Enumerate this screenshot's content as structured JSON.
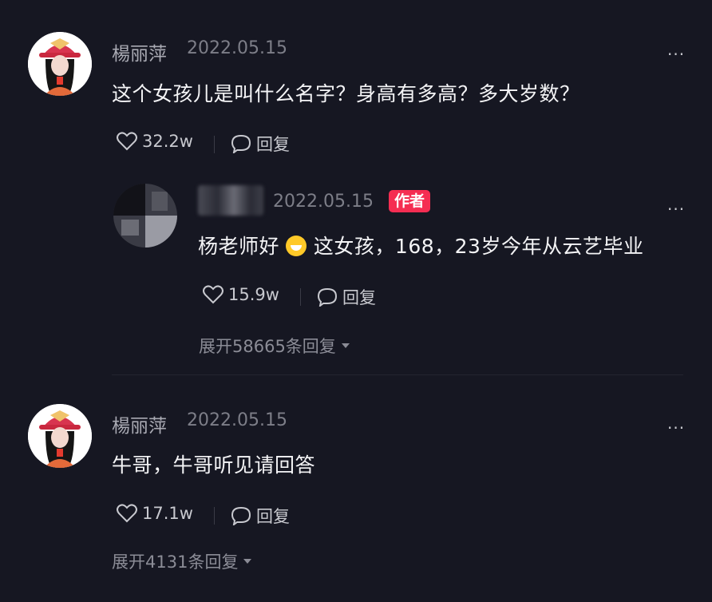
{
  "comments": [
    {
      "username": "楊丽萍",
      "date": "2022.05.15",
      "text": "这个女孩儿是叫什么名字？身高有多高？多大岁数？",
      "likes": "32.2w",
      "reply_label": "回复",
      "more_label": "···",
      "reply": {
        "date": "2022.05.15",
        "author_tag": "作者",
        "text_before": "杨老师好",
        "text_after": "这女孩，168，23岁今年从云艺毕业",
        "likes": "15.9w",
        "reply_label": "回复",
        "more_label": "···"
      },
      "expand_label": "展开58665条回复"
    },
    {
      "username": "楊丽萍",
      "date": "2022.05.15",
      "text": "牛哥，牛哥听见请回答",
      "likes": "17.1w",
      "reply_label": "回复",
      "more_label": "···",
      "expand_label": "展开4131条回复"
    }
  ],
  "icons": {
    "heart": "heart-icon",
    "reply": "comment-bubble-icon",
    "caret": "caret-down-icon"
  },
  "colors": {
    "background": "#161722",
    "author_tag": "#f52d52"
  }
}
